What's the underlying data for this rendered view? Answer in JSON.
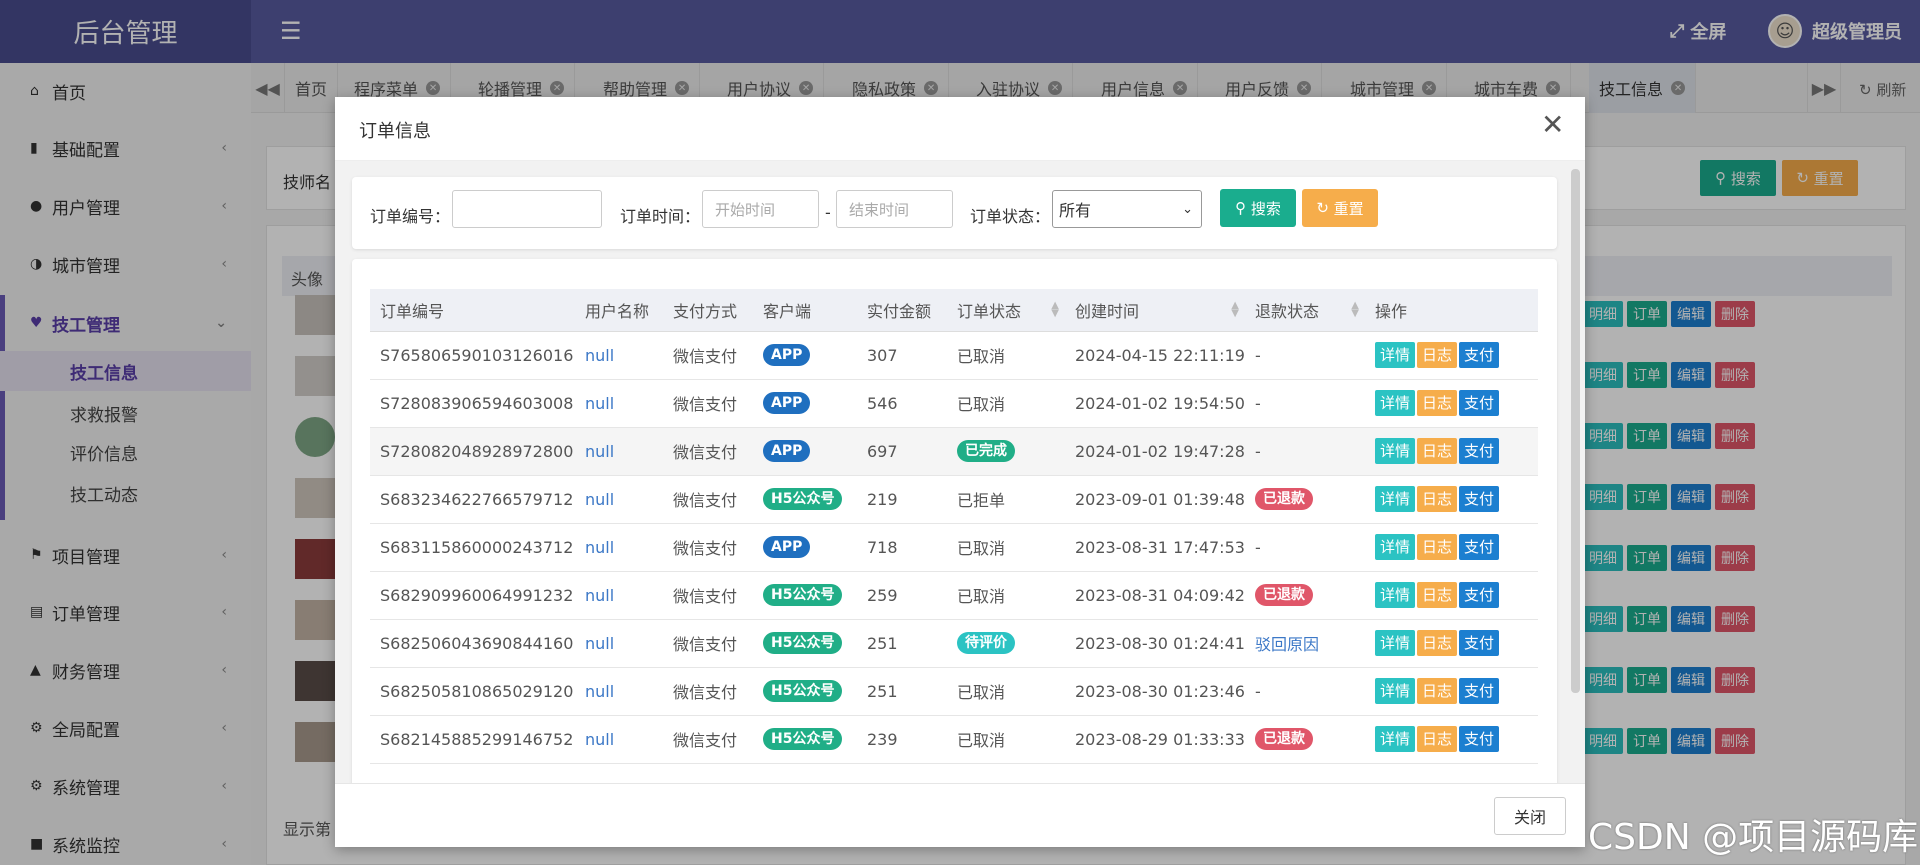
{
  "app": {
    "title": "后台管理",
    "fullscreen": "全屏",
    "user": "超级管理员"
  },
  "colors": {
    "topbar": "#585ba0",
    "primary": "#1aad8e",
    "warning": "#f6ad4b",
    "info": "#1c9fe0",
    "danger": "#e05669",
    "pill_blue": "#1f6fbf",
    "pill_green": "#20ae87",
    "pill_cyan": "#2bc3c3"
  },
  "sidebar": {
    "items": [
      {
        "label": "首页",
        "icon": "home-icon"
      },
      {
        "label": "基础配置",
        "icon": "bookmark-icon"
      },
      {
        "label": "用户管理",
        "icon": "user-icon"
      },
      {
        "label": "城市管理",
        "icon": "globe-icon"
      },
      {
        "label": "技工管理",
        "icon": "heart-icon"
      },
      {
        "label": "项目管理",
        "icon": "flag-icon"
      },
      {
        "label": "订单管理",
        "icon": "bar-chart-icon"
      },
      {
        "label": "财务管理",
        "icon": "area-chart-icon"
      },
      {
        "label": "全局配置",
        "icon": "gears-icon"
      },
      {
        "label": "系统管理",
        "icon": "gear-icon"
      },
      {
        "label": "系统监控",
        "icon": "video-icon"
      }
    ],
    "sub_items": [
      "技工信息",
      "求救报警",
      "评价信息",
      "技工动态"
    ]
  },
  "tabs": [
    "首页",
    "程序菜单",
    "轮播管理",
    "帮助管理",
    "用户协议",
    "隐私政策",
    "入驻协议",
    "用户信息",
    "用户反馈",
    "城市管理",
    "城市车费",
    "技工信息"
  ],
  "tabs_refresh": "刷新",
  "background": {
    "filter_label": "技师名",
    "search": "搜索",
    "reset": "重置",
    "avatar_header": "头像",
    "footer_text": "显示第",
    "row_buttons": [
      "明细",
      "订单",
      "编辑",
      "删除"
    ]
  },
  "modal": {
    "title": "订单信息",
    "filter": {
      "order_no_label": "订单编号：",
      "order_time_label": "订单时间：",
      "start_placeholder": "开始时间",
      "end_placeholder": "结束时间",
      "dash": "-",
      "status_label": "订单状态：",
      "status_value": "所有",
      "search": "搜索",
      "reset": "重置"
    },
    "columns": [
      "订单编号",
      "用户名称",
      "支付方式",
      "客户端",
      "实付金额",
      "订单状态",
      "创建时间",
      "退款状态",
      "操作"
    ],
    "actions": [
      "详情",
      "日志",
      "支付"
    ],
    "rows": [
      {
        "no": "S765806590103126016",
        "user": "null",
        "pay": "微信支付",
        "client": "APP",
        "amount": "307",
        "status": "已取消",
        "status_pill": false,
        "created": "2024-04-15 22:11:19",
        "refund": "-",
        "refund_type": "none"
      },
      {
        "no": "S728083906594603008",
        "user": "null",
        "pay": "微信支付",
        "client": "APP",
        "amount": "546",
        "status": "已取消",
        "status_pill": false,
        "created": "2024-01-02 19:54:50",
        "refund": "-",
        "refund_type": "none"
      },
      {
        "no": "S728082048928972800",
        "user": "null",
        "pay": "微信支付",
        "client": "APP",
        "amount": "697",
        "status": "已完成",
        "status_pill": true,
        "created": "2024-01-02 19:47:28",
        "refund": "-",
        "refund_type": "none"
      },
      {
        "no": "S683234622766579712",
        "user": "null",
        "pay": "微信支付",
        "client": "H5公众号",
        "amount": "219",
        "status": "已拒单",
        "status_pill": false,
        "created": "2023-09-01 01:39:48",
        "refund": "已退款",
        "refund_type": "pill"
      },
      {
        "no": "S683115860000243712",
        "user": "null",
        "pay": "微信支付",
        "client": "APP",
        "amount": "718",
        "status": "已取消",
        "status_pill": false,
        "created": "2023-08-31 17:47:53",
        "refund": "-",
        "refund_type": "none"
      },
      {
        "no": "S682909960064991232",
        "user": "null",
        "pay": "微信支付",
        "client": "H5公众号",
        "amount": "259",
        "status": "已取消",
        "status_pill": false,
        "created": "2023-08-31 04:09:42",
        "refund": "已退款",
        "refund_type": "pill"
      },
      {
        "no": "S682506043690844160",
        "user": "null",
        "pay": "微信支付",
        "client": "H5公众号",
        "amount": "251",
        "status": "待评价",
        "status_pill": true,
        "created": "2023-08-30 01:24:41",
        "refund": "驳回原因",
        "refund_type": "link"
      },
      {
        "no": "S682505810865029120",
        "user": "null",
        "pay": "微信支付",
        "client": "H5公众号",
        "amount": "251",
        "status": "已取消",
        "status_pill": false,
        "created": "2023-08-30 01:23:46",
        "refund": "-",
        "refund_type": "none"
      },
      {
        "no": "S682145885299146752",
        "user": "null",
        "pay": "微信支付",
        "client": "H5公众号",
        "amount": "239",
        "status": "已取消",
        "status_pill": false,
        "created": "2023-08-29 01:33:33",
        "refund": "已退款",
        "refund_type": "pill"
      }
    ],
    "close": "关闭"
  },
  "watermark": "CSDN @项目源码库"
}
